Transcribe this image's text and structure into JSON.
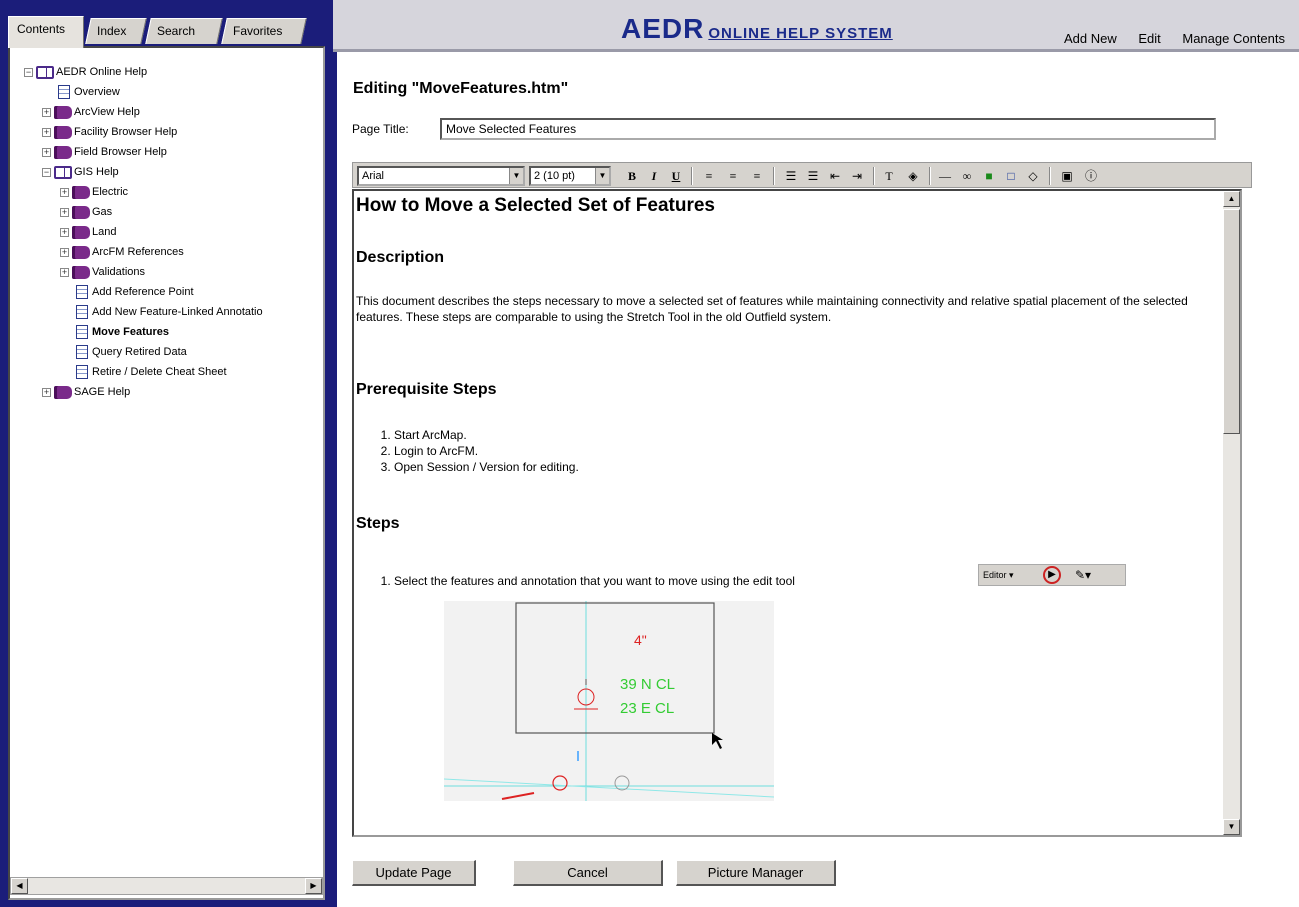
{
  "sidebar": {
    "tabs": [
      "Contents",
      "Index",
      "Search",
      "Favorites"
    ],
    "tree": [
      {
        "label": "AEDR Online Help",
        "kind": "book-open",
        "exp": "−"
      },
      {
        "label": "Overview",
        "kind": "page"
      },
      {
        "label": "ArcView Help",
        "kind": "book",
        "exp": "+"
      },
      {
        "label": "Facility Browser Help",
        "kind": "book",
        "exp": "+"
      },
      {
        "label": "Field Browser Help",
        "kind": "book",
        "exp": "+"
      },
      {
        "label": "GIS Help",
        "kind": "book-open",
        "exp": "−"
      },
      {
        "label": "Electric",
        "kind": "book",
        "exp": "+"
      },
      {
        "label": "Gas",
        "kind": "book",
        "exp": "+"
      },
      {
        "label": "Land",
        "kind": "book",
        "exp": "+"
      },
      {
        "label": "ArcFM References",
        "kind": "book",
        "exp": "+"
      },
      {
        "label": "Validations",
        "kind": "book",
        "exp": "+"
      },
      {
        "label": "Add Reference Point",
        "kind": "page"
      },
      {
        "label": "Add New Feature-Linked Annotatio",
        "kind": "page"
      },
      {
        "label": "Move Features",
        "kind": "page",
        "selected": true
      },
      {
        "label": "Query Retired Data",
        "kind": "page"
      },
      {
        "label": "Retire / Delete Cheat Sheet",
        "kind": "page"
      },
      {
        "label": "SAGE Help",
        "kind": "book",
        "exp": "+"
      }
    ]
  },
  "header": {
    "logo_big": "AEDR",
    "logo_small": "ONLINE HELP SYSTEM",
    "nav": [
      "Add New",
      "Edit",
      "Manage Contents"
    ]
  },
  "editor": {
    "heading": "Editing \"MoveFeatures.htm\"",
    "page_title_label": "Page Title:",
    "page_title_value": "Move Selected Features",
    "font_value": "Arial",
    "size_value": "2 (10 pt)",
    "toolbar_buttons": [
      "B",
      "I",
      "U"
    ]
  },
  "doc": {
    "title": "How to Move a Selected Set of Features",
    "h_description": "Description",
    "description": "This document describes the steps necessary to move a selected set of features while maintaining connectivity and relative spatial placement of the selected features. These steps are comparable to using the Stretch Tool in the old Outfield system.",
    "h_prereq": "Prerequisite Steps",
    "prereq_steps": [
      "Start ArcMap.",
      "Login to ArcFM.",
      "Open Session / Version for editing."
    ],
    "h_steps": "Steps",
    "steps": [
      "Select the features and annotation that you want to move using the edit tool"
    ],
    "editor_tool_label": "Editor ▾",
    "map_labels": [
      "4\"",
      "39 N CL",
      "23 E CL"
    ]
  },
  "buttons": {
    "update": "Update Page",
    "cancel": "Cancel",
    "picture_manager": "Picture Manager"
  },
  "colors": {
    "sidebar_bg": "#1b1d7a",
    "logo": "#1a2a8a",
    "map_green": "#33cc33",
    "map_red": "#dd2222"
  }
}
